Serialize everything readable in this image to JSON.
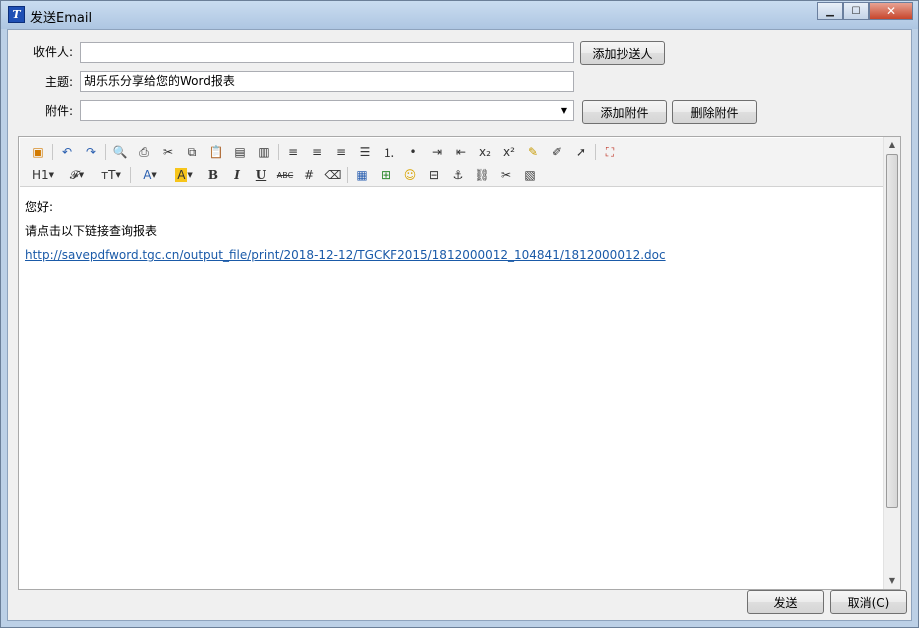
{
  "window": {
    "title": "发送Email"
  },
  "form": {
    "recipient": {
      "label": "收件人:",
      "value": ""
    },
    "subject": {
      "label": "主题:",
      "value": "胡乐乐分享给您的Word报表"
    },
    "attachment": {
      "label": "附件:",
      "value": ""
    },
    "add_cc_label": "添加抄送人",
    "add_attachment_label": "添加附件",
    "delete_attachment_label": "删除附件"
  },
  "toolbar": {
    "heading_label": "H1",
    "font_family_label": "𝓕",
    "font_size_label": "тT",
    "font_color_label": "A",
    "highlight_label": "A",
    "bold_label": "B",
    "italic_label": "I",
    "underline_label": "U",
    "strikethrough_label": "ABC"
  },
  "message": {
    "greeting": "您好:",
    "instruction": "请点击以下链接查询报表",
    "link": "http://savepdfword.tgc.cn/output_file/print/2018-12-12/TGCKF2015/1812000012_104841/1812000012.doc"
  },
  "footer": {
    "send_label": "发送",
    "cancel_label": "取消(C)"
  },
  "colors": {
    "titlebar": "#c9dcf0",
    "link": "#1a5aa8",
    "close_button": "#c7462c"
  }
}
